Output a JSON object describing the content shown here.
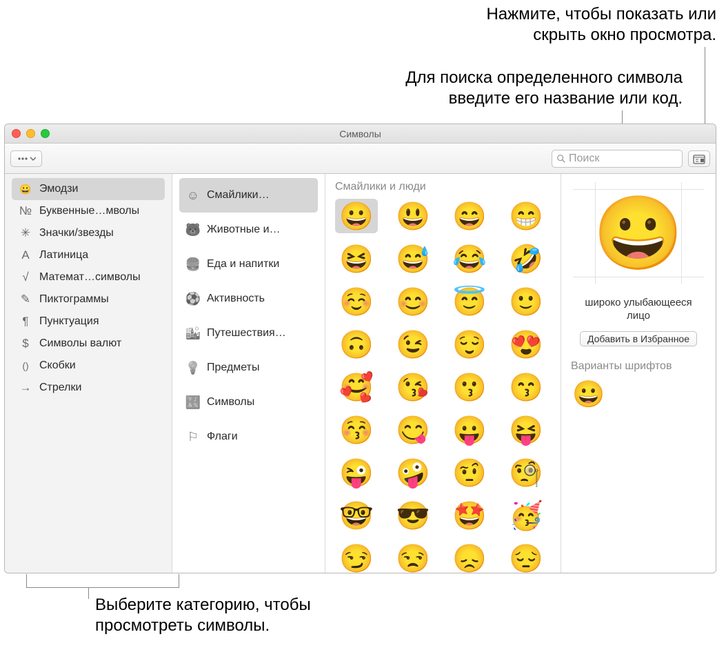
{
  "callouts": {
    "top_right_1": "Нажмите, чтобы показать или\nскрыть окно просмотра.",
    "top_right_2": "Для поиска определенного символа\nвведите его название или код.",
    "bottom": "Выберите категорию, чтобы\nпросмотреть символы."
  },
  "window": {
    "title": "Символы",
    "search_placeholder": "Поиск"
  },
  "sidebar": [
    {
      "icon": "😀",
      "label": "Эмодзи",
      "selected": true,
      "name": "emoji"
    },
    {
      "icon": "№",
      "label": "Буквенные…мволы",
      "name": "letterlike"
    },
    {
      "icon": "✳",
      "label": "Значки/звезды",
      "name": "bullets"
    },
    {
      "icon": "A",
      "label": "Латиница",
      "name": "latin"
    },
    {
      "icon": "√",
      "label": "Математ…символы",
      "name": "math"
    },
    {
      "icon": "✎",
      "label": "Пиктограммы",
      "name": "pictographs"
    },
    {
      "icon": "¶",
      "label": "Пунктуация",
      "name": "punctuation"
    },
    {
      "icon": "$",
      "label": "Символы валют",
      "name": "currency"
    },
    {
      "icon": "()",
      "label": "Скобки",
      "name": "brackets"
    },
    {
      "icon": "→",
      "label": "Стрелки",
      "name": "arrows"
    }
  ],
  "subcategories": [
    {
      "icon": "☺",
      "label": "Смайлики…",
      "selected": true,
      "name": "smileys"
    },
    {
      "icon": "🐻",
      "label": "Животные и…",
      "name": "animals"
    },
    {
      "icon": "🍔",
      "label": "Еда и напитки",
      "name": "food"
    },
    {
      "icon": "⚽",
      "label": "Активность",
      "name": "activity"
    },
    {
      "icon": "🏙",
      "label": "Путешествия…",
      "name": "travel"
    },
    {
      "icon": "💡",
      "label": "Предметы",
      "name": "objects"
    },
    {
      "icon": "🔣",
      "label": "Символы",
      "name": "symbols"
    },
    {
      "icon": "⚐",
      "label": "Флаги",
      "name": "flags"
    }
  ],
  "grid": {
    "title": "Смайлики и люди",
    "items": [
      {
        "e": "😀",
        "sel": true
      },
      {
        "e": "😃"
      },
      {
        "e": "😄"
      },
      {
        "e": "😁"
      },
      {
        "e": "😆"
      },
      {
        "e": "😅"
      },
      {
        "e": "😂"
      },
      {
        "e": "🤣"
      },
      {
        "e": "☺️"
      },
      {
        "e": "😊"
      },
      {
        "e": "😇"
      },
      {
        "e": "🙂"
      },
      {
        "e": "🙃"
      },
      {
        "e": "😉"
      },
      {
        "e": "😌"
      },
      {
        "e": "😍"
      },
      {
        "e": "🥰"
      },
      {
        "e": "😘"
      },
      {
        "e": "😗"
      },
      {
        "e": "😙"
      },
      {
        "e": "😚"
      },
      {
        "e": "😋"
      },
      {
        "e": "😛"
      },
      {
        "e": "😝"
      },
      {
        "e": "😜"
      },
      {
        "e": "🤪"
      },
      {
        "e": "🤨"
      },
      {
        "e": "🧐"
      },
      {
        "e": "🤓"
      },
      {
        "e": "😎"
      },
      {
        "e": "🤩"
      },
      {
        "e": "🥳"
      },
      {
        "e": "😏"
      },
      {
        "e": "😒"
      },
      {
        "e": "😞"
      },
      {
        "e": "😔"
      }
    ]
  },
  "preview": {
    "emoji": "😀",
    "name": "широко улыбающееся\nлицо",
    "fav_button": "Добавить в Избранное",
    "variants_title": "Варианты шрифтов",
    "variant": "😀"
  }
}
